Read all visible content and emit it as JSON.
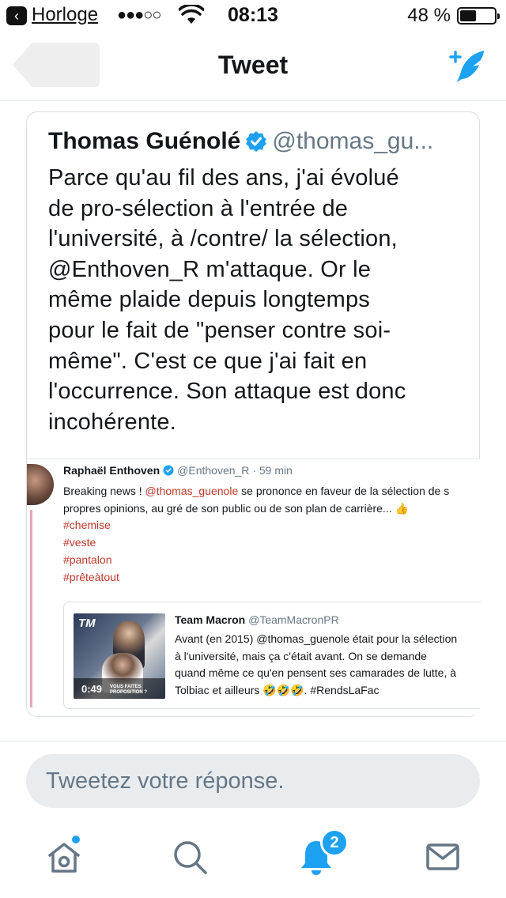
{
  "status_bar": {
    "back_app": "Horloge",
    "signal": "●●●○○",
    "time": "08:13",
    "battery_percent": "48 %",
    "battery_level": 0.48
  },
  "nav": {
    "title": "Tweet",
    "compose_icon": "compose-tweet-icon"
  },
  "tweet": {
    "author_name": "Thomas Guénolé",
    "author_handle": "@thomas_gu...",
    "verified": true,
    "text_lines": [
      "Parce qu'au fil des ans, j'ai évolué",
      "de pro-sélection à l'entrée de",
      "l'université, à /contre/ la sélection,",
      "@Enthoven_R m'attaque. Or le",
      "même plaide depuis longtemps",
      "pour le fait de \"penser contre soi-",
      "même\". C'est ce que j'ai fait en",
      "l'occurrence. Son attaque est donc",
      "incohérente."
    ],
    "embedded": {
      "author_name": "Raphaël Enthoven",
      "author_handle": "@Enthoven_R",
      "time": "· 59 min",
      "line1_prefix": "Breaking news ! ",
      "line1_mention": "@thomas_guenole",
      "line1_suffix": " se prononce en faveur de la sélection de s",
      "line2": "propres opinions, au gré de son public ou de son plan de carrière... ",
      "line2_emoji": "👍",
      "hashtags": [
        "#chemise",
        "#veste",
        "#pantalon",
        "#prêteàtout"
      ],
      "quoted": {
        "author_name": "Team Macron",
        "author_handle": "@TeamMacronPR",
        "media_logo": "TM",
        "media_duration": "0:49",
        "media_caption": "VOUS FAITES PROPOSITION ?",
        "lines": [
          "Avant (en 2015) @thomas_guenole était pour la sélection",
          "à l'université, mais ça c'était avant. On se demande",
          "quand même ce qu'en pensent ses camarades de lutte, à",
          "Tolbiac et ailleurs 🤣🤣🤣. #RendsLaFac"
        ]
      }
    }
  },
  "reply": {
    "placeholder": "Tweetez votre réponse."
  },
  "tabs": [
    {
      "name": "home",
      "icon": "home-icon",
      "has_dot": true
    },
    {
      "name": "search",
      "icon": "search-icon"
    },
    {
      "name": "notifications",
      "icon": "bell-icon",
      "badge": "2"
    },
    {
      "name": "messages",
      "icon": "envelope-icon"
    }
  ],
  "colors": {
    "accent": "#1da1f2",
    "text": "#14171a",
    "secondary": "#657786",
    "hashtag": "#c0392b"
  }
}
